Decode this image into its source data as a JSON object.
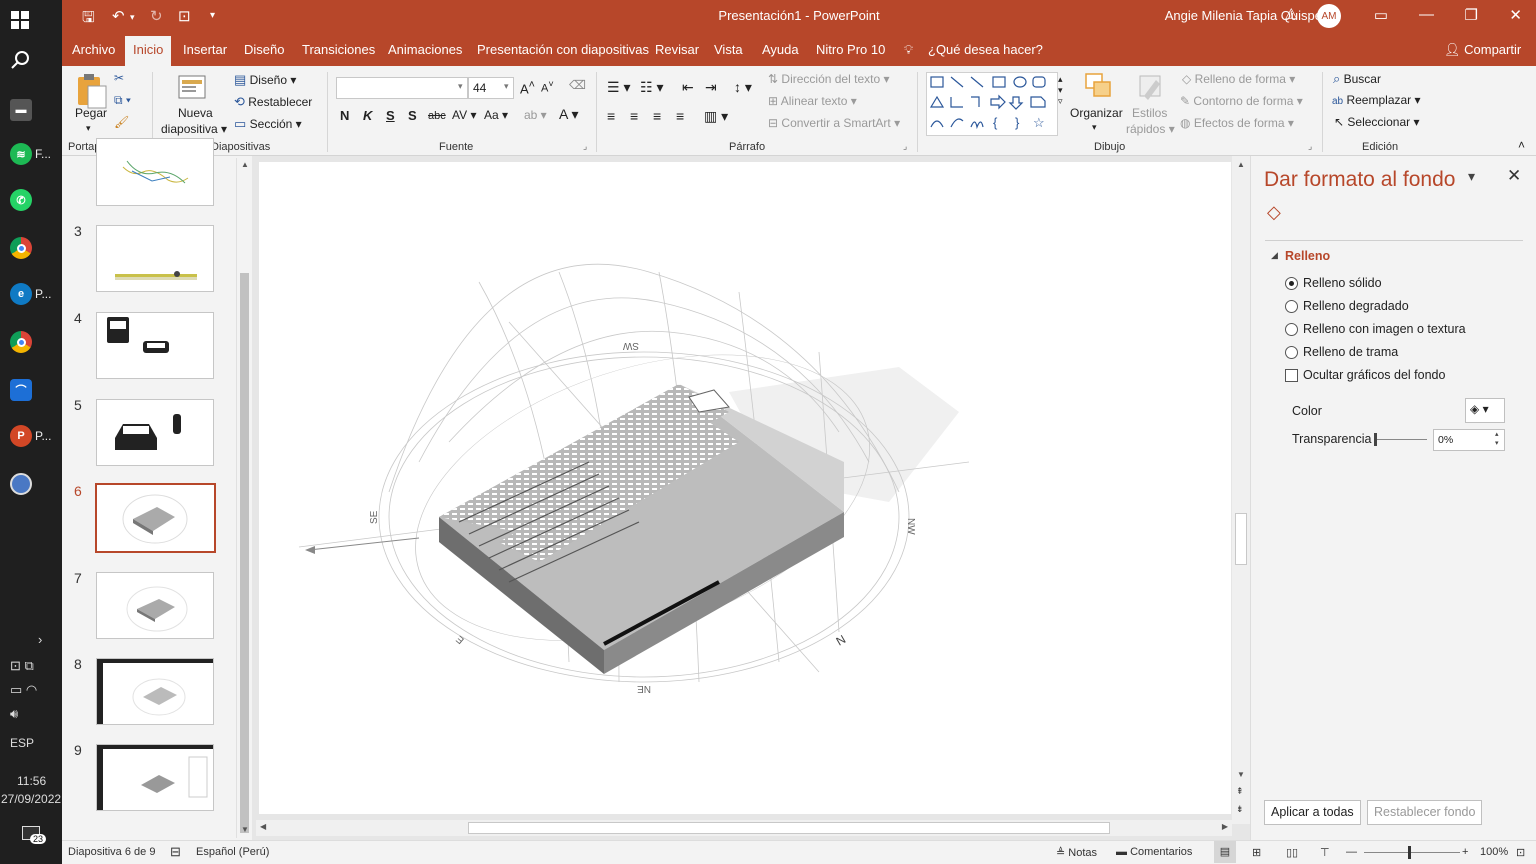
{
  "taskbar": {
    "apps": [
      {
        "name": "windows-start-icon",
        "label": ""
      },
      {
        "name": "search-icon",
        "label": ""
      },
      {
        "name": "app-icon",
        "label": ""
      },
      {
        "name": "spotify-icon",
        "label": "F..."
      },
      {
        "name": "whatsapp-icon",
        "label": ""
      },
      {
        "name": "chrome-icon",
        "label": ""
      },
      {
        "name": "edge-icon",
        "label": "P..."
      },
      {
        "name": "chrome-profile-icon",
        "label": ""
      },
      {
        "name": "app-blue-icon",
        "label": ""
      },
      {
        "name": "powerpoint-icon",
        "label": "P..."
      },
      {
        "name": "google-earth-icon",
        "label": ""
      }
    ],
    "language": "ESP",
    "time": "11:56",
    "date": "27/09/2022",
    "notifications": "23"
  },
  "titlebar": {
    "title": "Presentación1  -  PowerPoint",
    "user": "Angie Milenia Tapia Quispe",
    "initials": "AM"
  },
  "tabs": [
    {
      "label": "Archivo",
      "active": false
    },
    {
      "label": "Inicio",
      "active": true
    },
    {
      "label": "Insertar",
      "active": false
    },
    {
      "label": "Diseño",
      "active": false
    },
    {
      "label": "Transiciones",
      "active": false
    },
    {
      "label": "Animaciones",
      "active": false
    },
    {
      "label": "Presentación con diapositivas",
      "active": false
    },
    {
      "label": "Revisar",
      "active": false
    },
    {
      "label": "Vista",
      "active": false
    },
    {
      "label": "Ayuda",
      "active": false
    },
    {
      "label": "Nitro Pro 10",
      "active": false
    }
  ],
  "tell_me": "¿Qué desea hacer?",
  "share": "Compartir",
  "ribbon": {
    "clipboard": {
      "paste": "Pegar",
      "group": "Portapapeles"
    },
    "slides": {
      "new_slide_1": "Nueva",
      "new_slide_2": "diapositiva",
      "layout": "Diseño",
      "reset": "Restablecer",
      "section": "Sección",
      "group": "Diapositivas"
    },
    "font": {
      "font_name": "",
      "font_size": "44",
      "group": "Fuente"
    },
    "paragraph": {
      "text_direction": "Dirección del texto",
      "align_text": "Alinear texto",
      "smartart": "Convertir a SmartArt",
      "group": "Párrafo"
    },
    "drawing": {
      "arrange": "Organizar",
      "quick_styles_1": "Estilos",
      "quick_styles_2": "rápidos",
      "shape_fill": "Relleno de forma",
      "shape_outline": "Contorno de forma",
      "shape_effects": "Efectos de forma",
      "group": "Dibujo"
    },
    "editing": {
      "find": "Buscar",
      "replace": "Reemplazar",
      "select": "Seleccionar",
      "group": "Edición"
    }
  },
  "slides": [
    {
      "number": "",
      "active": false
    },
    {
      "number": "3",
      "active": false
    },
    {
      "number": "4",
      "active": false
    },
    {
      "number": "5",
      "active": false
    },
    {
      "number": "6",
      "active": true
    },
    {
      "number": "7",
      "active": false
    },
    {
      "number": "8",
      "active": false
    },
    {
      "number": "9",
      "active": false
    }
  ],
  "slide_compass_labels": [
    "SW",
    "NW",
    "N",
    "NE",
    "SE",
    "E"
  ],
  "pane": {
    "title": "Dar formato al fondo",
    "section": "Relleno",
    "options": [
      {
        "label": "Relleno sólido",
        "checked": true
      },
      {
        "label": "Relleno degradado",
        "checked": false
      },
      {
        "label": "Relleno con imagen o textura",
        "checked": false
      },
      {
        "label": "Relleno de trama",
        "checked": false
      }
    ],
    "hide_graphics": "Ocultar gráficos del fondo",
    "color_label": "Color",
    "transparency_label": "Transparencia",
    "transparency_value": "0%",
    "apply_all": "Aplicar a todas",
    "reset_bg": "Restablecer fondo"
  },
  "status": {
    "slide_info": "Diapositiva 6 de 9",
    "language": "Español (Perú)",
    "notes": "Notas",
    "comments": "Comentarios",
    "zoom": "100%"
  }
}
